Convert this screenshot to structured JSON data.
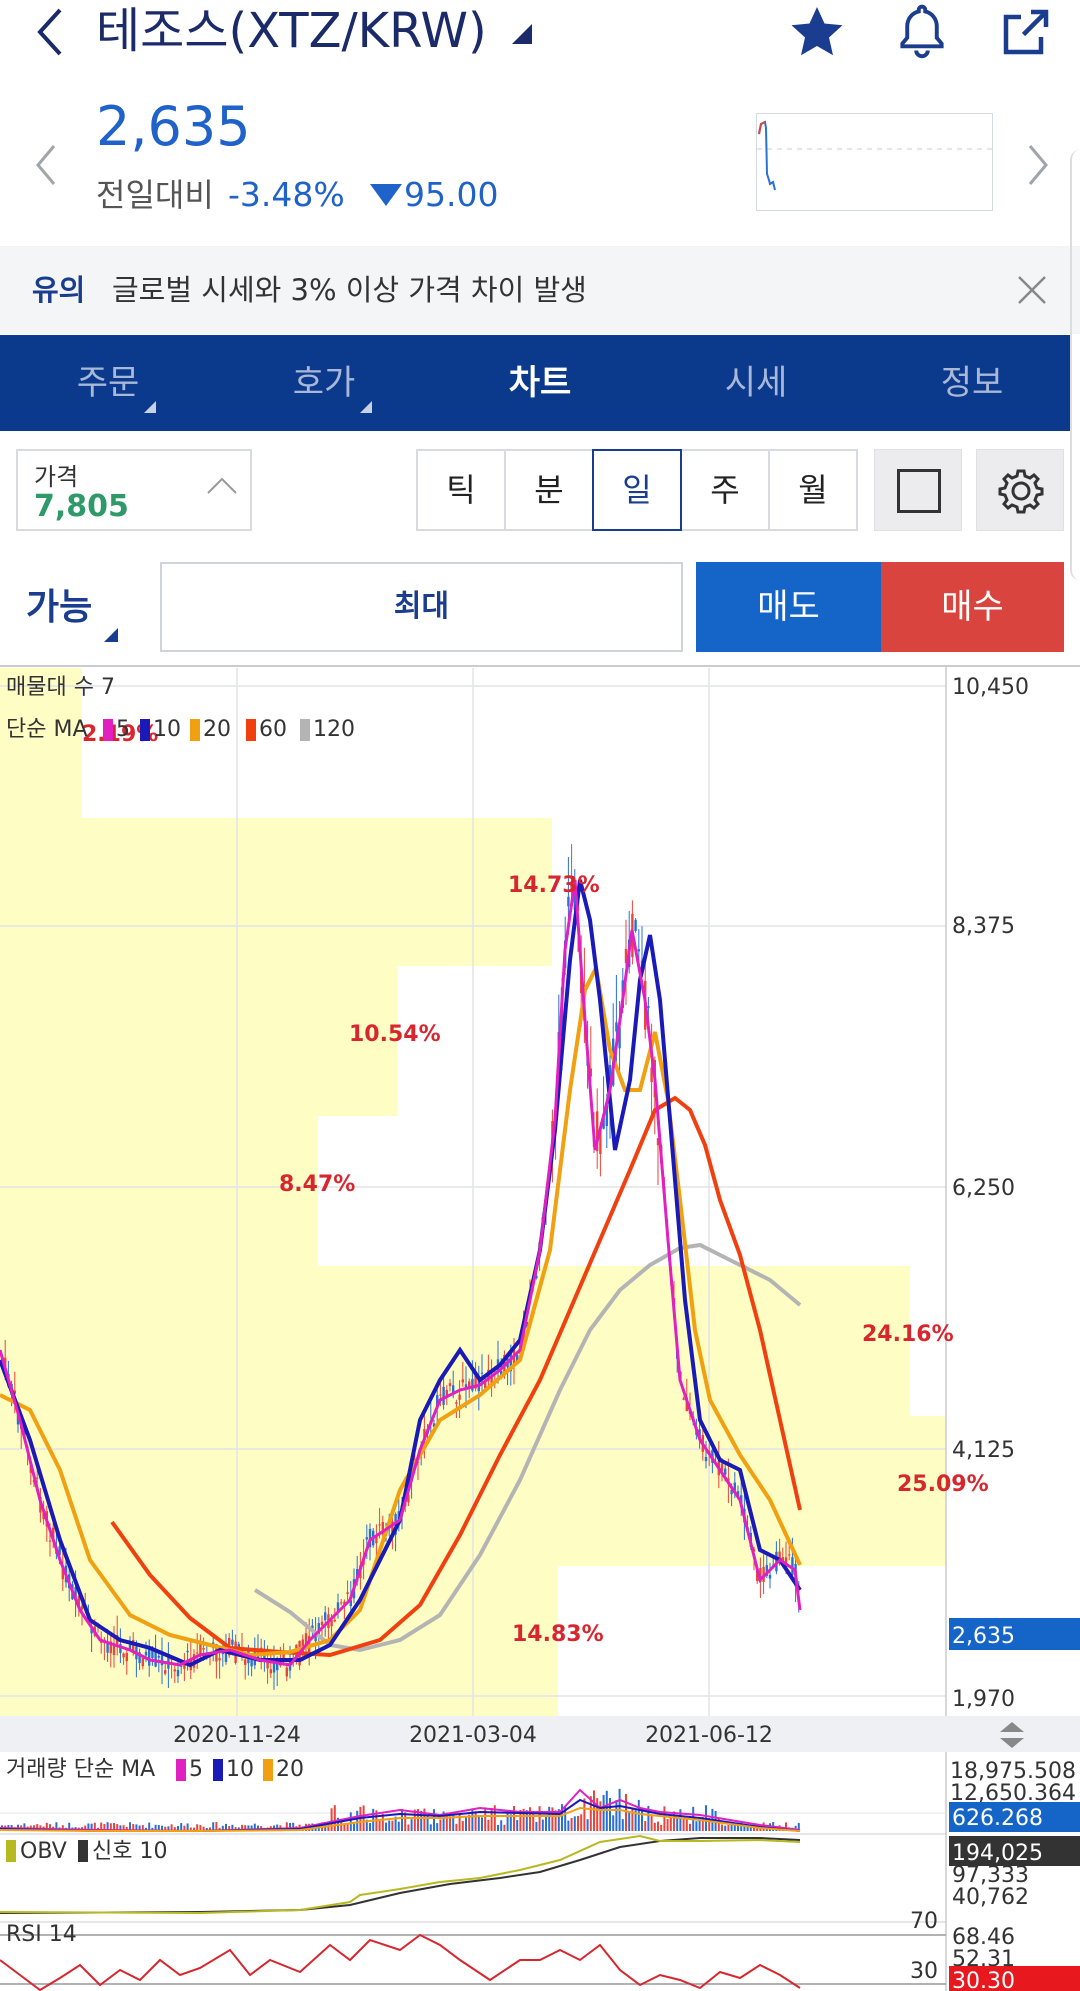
{
  "header": {
    "title": "테조스(XTZ/KRW)",
    "price": "2,635",
    "diff_label": "전일대비",
    "diff_pct": "-3.48%",
    "diff_amount": "95.00"
  },
  "notice": {
    "tag": "유의",
    "text": "글로벌 시세와 3% 이상 가격 차이 발생"
  },
  "tabs": [
    {
      "label": "주문"
    },
    {
      "label": "호가"
    },
    {
      "label": "차트"
    },
    {
      "label": "시세"
    },
    {
      "label": "정보"
    }
  ],
  "toolbar": {
    "price_label": "가격",
    "price_value": "7,805",
    "periods": [
      "틱",
      "분",
      "일",
      "주",
      "월"
    ],
    "active_period": "일"
  },
  "order": {
    "available_label": "가능",
    "max_label": "최대",
    "sell_label": "매도",
    "buy_label": "매수"
  },
  "chart": {
    "legend_volume_profile": "매물대 수 7",
    "legend_ma_prefix": "단순 MA",
    "ma_periods": [
      "5",
      "10",
      "20",
      "60",
      "120"
    ],
    "ma_colors": [
      "#e020c0",
      "#1a1ab8",
      "#f0a010",
      "#f04010",
      "#b0b0b0"
    ],
    "price_axis": [
      "10,450",
      "8,375",
      "6,250",
      "4,125",
      "1,970"
    ],
    "current_price_tag": "2,635",
    "date_axis": [
      "2020-11-24",
      "2021-03-04",
      "2021-06-12"
    ],
    "volume_profile_pcts": [
      "2.19%",
      "14.73%",
      "10.54%",
      "8.47%",
      "24.16%",
      "25.09%",
      "14.83%"
    ]
  },
  "volume_panel": {
    "legend_prefix": "거래량 단순 MA",
    "ma_periods": [
      "5",
      "10",
      "20"
    ],
    "axis_top": "18,975.508",
    "axis_second": "12,650.364",
    "tag": "626.268"
  },
  "obv_panel": {
    "legend_obv": "OBV",
    "legend_signal": "신호 10",
    "tag": "194,025",
    "axis_a": "97,333",
    "axis_b": "40,762"
  },
  "rsi_panel": {
    "legend": "RSI 14",
    "level_high": "70",
    "level_low": "30",
    "axis_a": "68.46",
    "axis_b": "52.31",
    "tag": "30.30"
  }
}
